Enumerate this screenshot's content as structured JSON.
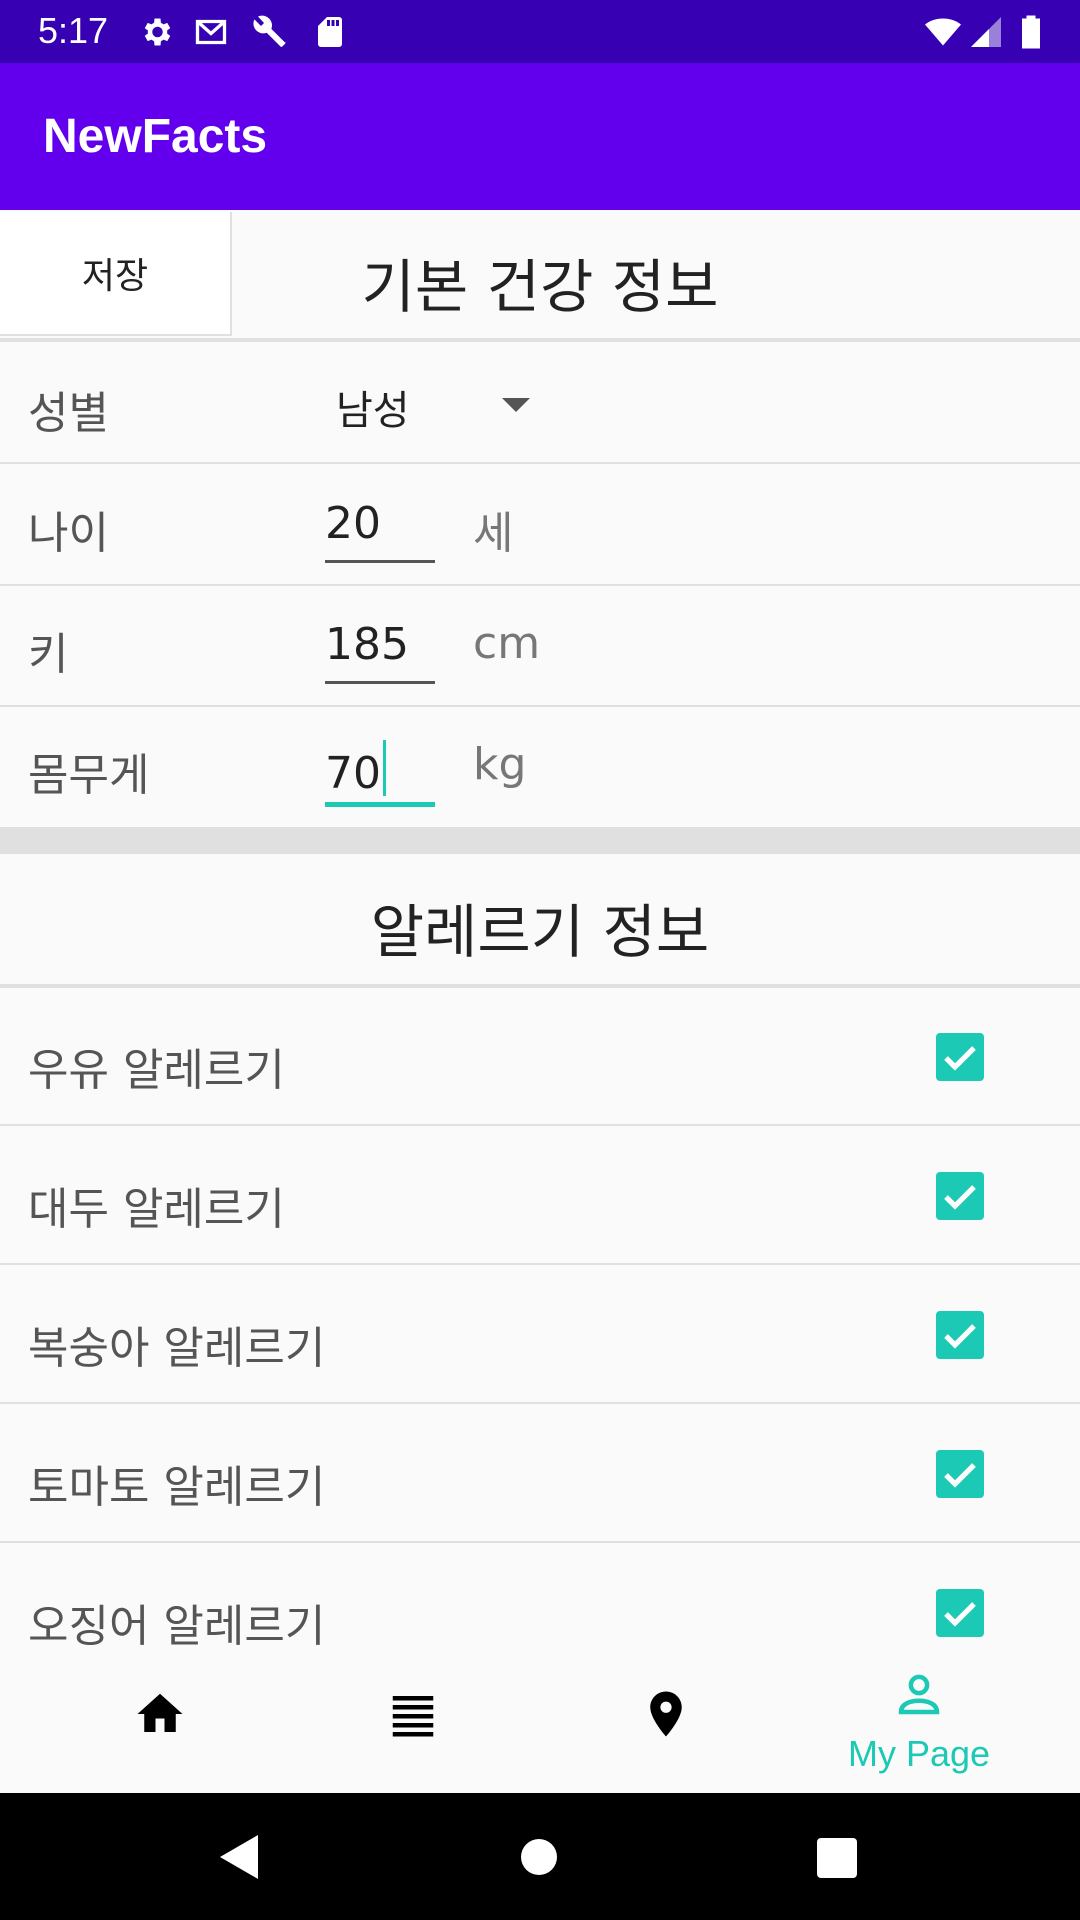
{
  "status_bar": {
    "time": "5:17"
  },
  "app_bar": {
    "title": "NewFacts"
  },
  "basic_health": {
    "save_label": "저장",
    "title": "기본 건강 정보",
    "gender": {
      "label": "성별",
      "value": "남성"
    },
    "age": {
      "label": "나이",
      "value": "20",
      "unit": "세"
    },
    "height": {
      "label": "키",
      "value": "185",
      "unit": "cm"
    },
    "weight": {
      "label": "몸무게",
      "value": "70",
      "unit": "kg"
    }
  },
  "allergy": {
    "title": "알레르기 정보",
    "items": [
      {
        "label": "우유 알레르기",
        "checked": true
      },
      {
        "label": "대두 알레르기",
        "checked": true
      },
      {
        "label": "복숭아 알레르기",
        "checked": true
      },
      {
        "label": "토마토 알레르기",
        "checked": true
      },
      {
        "label": "오징어 알레르기",
        "checked": true
      }
    ]
  },
  "bottom_nav": {
    "items": [
      {
        "icon": "home-icon"
      },
      {
        "icon": "list-icon"
      },
      {
        "icon": "location-pin-icon"
      },
      {
        "icon": "person-icon",
        "label": "My Page",
        "active": true
      }
    ]
  },
  "colors": {
    "status_bar": "#3700b3",
    "app_bar": "#6200ee",
    "accent": "#1bc9b5"
  }
}
